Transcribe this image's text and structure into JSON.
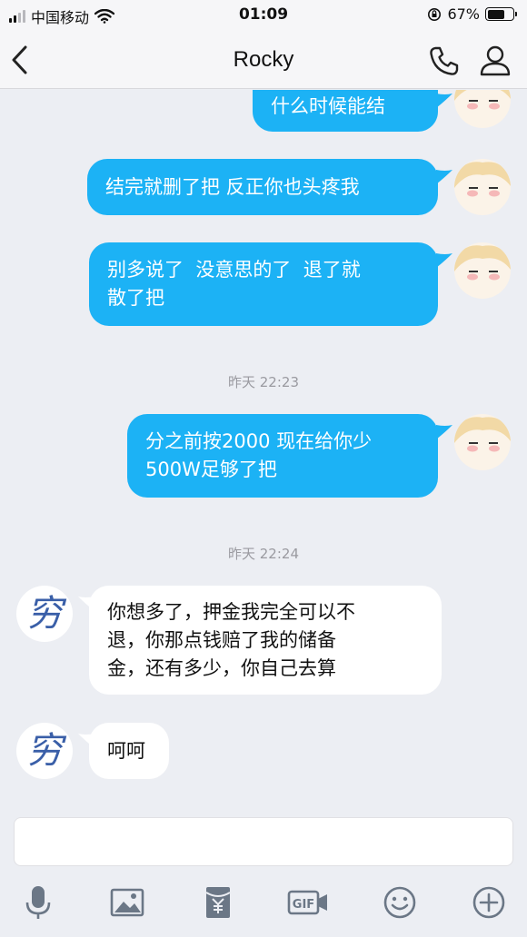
{
  "status_bar": {
    "carrier": "中国移动",
    "time": "01:09",
    "battery_percent": "67%",
    "battery_level": 0.67
  },
  "nav": {
    "title": "Rocky"
  },
  "messages": [
    {
      "direction": "out",
      "text": "什么时候能结"
    },
    {
      "direction": "out",
      "text": "结完就删了把 反正你也头疼我"
    },
    {
      "direction": "out",
      "lines": [
        "别多说了  没意思的了  退了就",
        "散了把"
      ]
    },
    {
      "direction": "out",
      "lines": [
        "分之前按2000 现在给你少",
        "500W足够了把"
      ]
    },
    {
      "direction": "in",
      "lines": [
        "你想多了，押金我完全可以不",
        "退，你那点钱赔了我的储备",
        "金，还有多少，你自己去算"
      ]
    },
    {
      "direction": "in",
      "text": "呵呵"
    }
  ],
  "timestamps": [
    "昨天 22:23",
    "昨天 22:24"
  ],
  "contact_avatar_glyph": "穷",
  "colors": {
    "outgoing_bubble": "#1cb2f5",
    "incoming_bubble": "#ffffff",
    "background": "#eceef3"
  },
  "toolbar_icons": [
    "microphone-icon",
    "image-icon",
    "red-packet-icon",
    "gif-icon",
    "emoji-icon",
    "plus-icon"
  ]
}
